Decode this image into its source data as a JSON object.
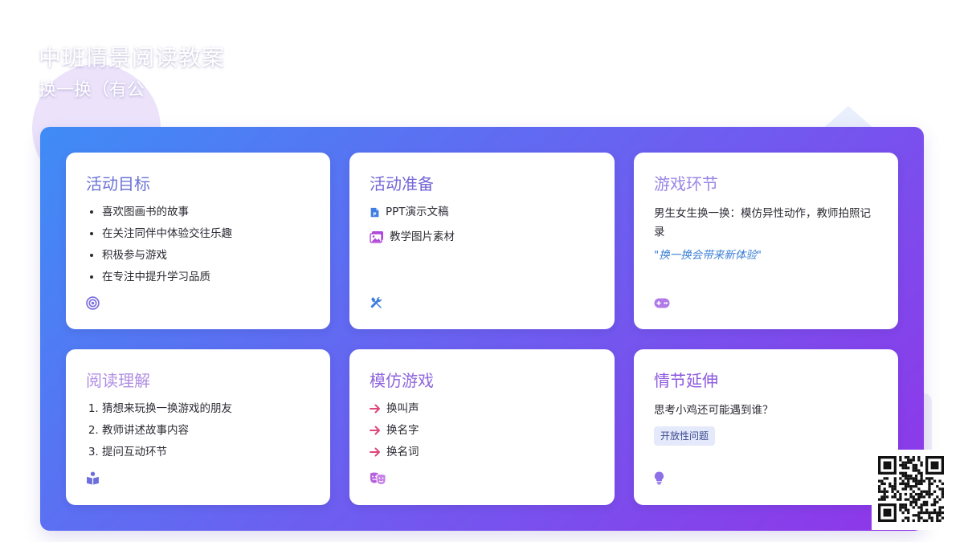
{
  "page": {
    "title": "中班情景阅读教案",
    "subtitle": "换一换（有公"
  },
  "colors": {
    "gradient_start": "#3f8cf6",
    "gradient_end": "#9035e8",
    "accent_blue": "#3c7fd6",
    "arrow_pink": "#e0457b",
    "tag_background": "#e4e9fb"
  },
  "cards": {
    "goals": {
      "title": "活动目标",
      "items": [
        "喜欢图画书的故事",
        "在关注同伴中体验交往乐趣",
        "积极参与游戏",
        "在专注中提升学习品质"
      ],
      "icon": "target-icon"
    },
    "preparation": {
      "title": "活动准备",
      "items": [
        {
          "icon": "ppt-file-icon",
          "label": "PPT演示文稿"
        },
        {
          "icon": "images-icon",
          "label": "教学图片素材"
        }
      ],
      "icon": "tools-icon"
    },
    "game": {
      "title": "游戏环节",
      "text": "男生女生换一换：模仿异性动作，教师拍照记录",
      "quote": "\"换一换会带来新体验\"",
      "icon": "gamepad-icon"
    },
    "reading": {
      "title": "阅读理解",
      "items": [
        "猜想来玩换一换游戏的朋友",
        "教师讲述故事内容",
        "提问互动环节"
      ],
      "icon": "book-reader-icon"
    },
    "imitation": {
      "title": "模仿游戏",
      "items": [
        "换叫声",
        "换名字",
        "换名词"
      ],
      "icon": "theater-masks-icon"
    },
    "extension": {
      "title": "情节延伸",
      "text": "思考小鸡还可能遇到谁？",
      "tag": "开放性问题",
      "icon": "lightbulb-icon"
    }
  },
  "qr": {
    "icon": "qr-code-icon"
  }
}
